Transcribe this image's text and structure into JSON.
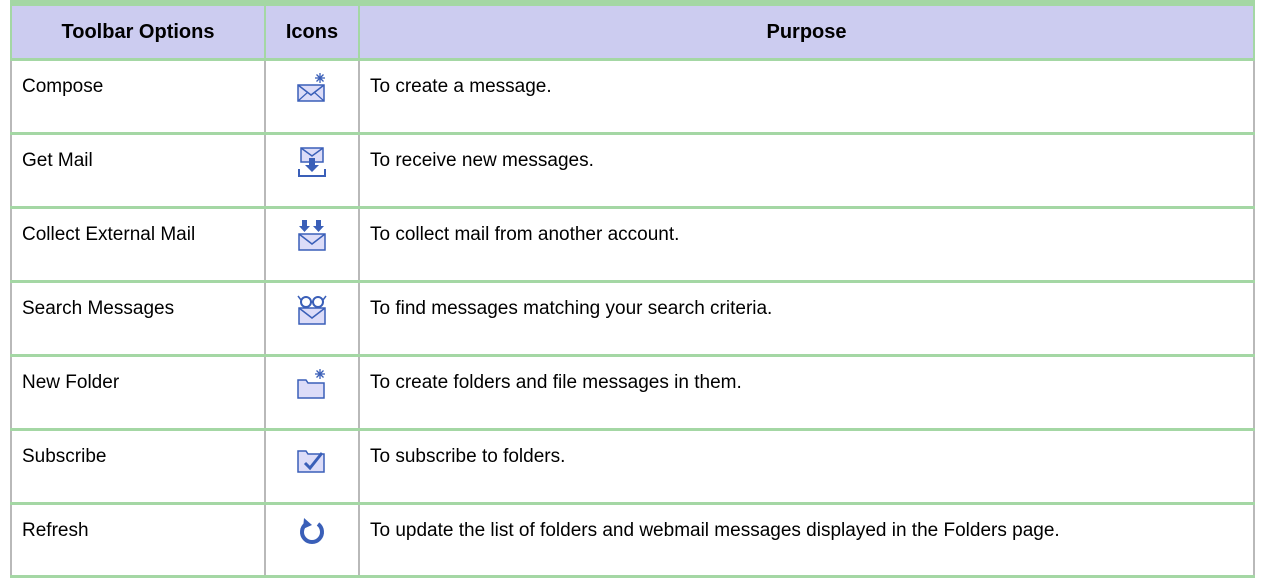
{
  "table": {
    "headers": [
      "Toolbar Options",
      "Icons",
      "Purpose"
    ],
    "rows": [
      {
        "option": "Compose",
        "icon": "compose-icon",
        "purpose": "To create a message."
      },
      {
        "option": "Get Mail",
        "icon": "get-mail-icon",
        "purpose": "To receive new messages."
      },
      {
        "option": "Collect External Mail",
        "icon": "collect-external-mail-icon",
        "purpose": "To collect mail from another account."
      },
      {
        "option": "Search Messages",
        "icon": "search-messages-icon",
        "purpose": "To find messages matching your search criteria."
      },
      {
        "option": "New Folder",
        "icon": "new-folder-icon",
        "purpose": "To create folders and file messages in them."
      },
      {
        "option": "Subscribe",
        "icon": "subscribe-icon",
        "purpose": "To subscribe to folders."
      },
      {
        "option": "Refresh",
        "icon": "refresh-icon",
        "purpose": "To update the list of folders and webmail messages displayed in the Folders page."
      }
    ]
  },
  "colors": {
    "header_bg": "#ccccf0",
    "row_divider": "#a4d7a4",
    "icon_blue": "#3a5fb8",
    "icon_envelope": "#dcdcf8"
  }
}
